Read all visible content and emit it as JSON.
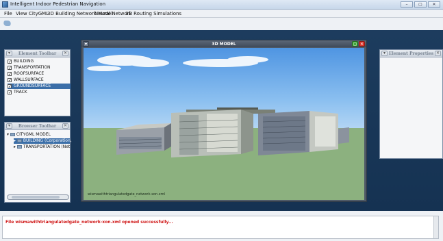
{
  "window": {
    "title": "Intelligent Indoor Pedestrian Navigation",
    "minimize": "–",
    "maximize": "▢",
    "close": "✕"
  },
  "menu": [
    "File",
    "View",
    "CityGML",
    "3D Building Network Model",
    "Neural Network",
    "3D Routing Simulations"
  ],
  "element_toolbar": {
    "title": "Element Toolbar",
    "items": [
      {
        "label": "BUILDING",
        "checked": true
      },
      {
        "label": "TRANSPORTATION",
        "checked": true
      },
      {
        "label": "ROOFSURFACE",
        "checked": true
      },
      {
        "label": "WALLSURFACE",
        "checked": true
      },
      {
        "label": "GROUNDSURFACE",
        "checked": true,
        "selected": true
      },
      {
        "label": "TRACK",
        "checked": true
      }
    ]
  },
  "browser_toolbar": {
    "title": "Browser Toolbar",
    "root": "CITYGML MODEL",
    "children": [
      "BUILDING (Corporation,",
      "TRANSPORTATION (Net"
    ]
  },
  "model_window": {
    "title": "3D MODEL",
    "caption": "wismawithtriangulatedgate_network-xon.xml"
  },
  "element_properties": {
    "title": "Element Properties"
  },
  "status": {
    "message": "File wismawithtriangulatedgate_network-xon.xml opened successfully..."
  },
  "colors": {
    "desktop": "#1d3a5a",
    "status_text": "#d01818",
    "selection": "#3b6ea8"
  }
}
